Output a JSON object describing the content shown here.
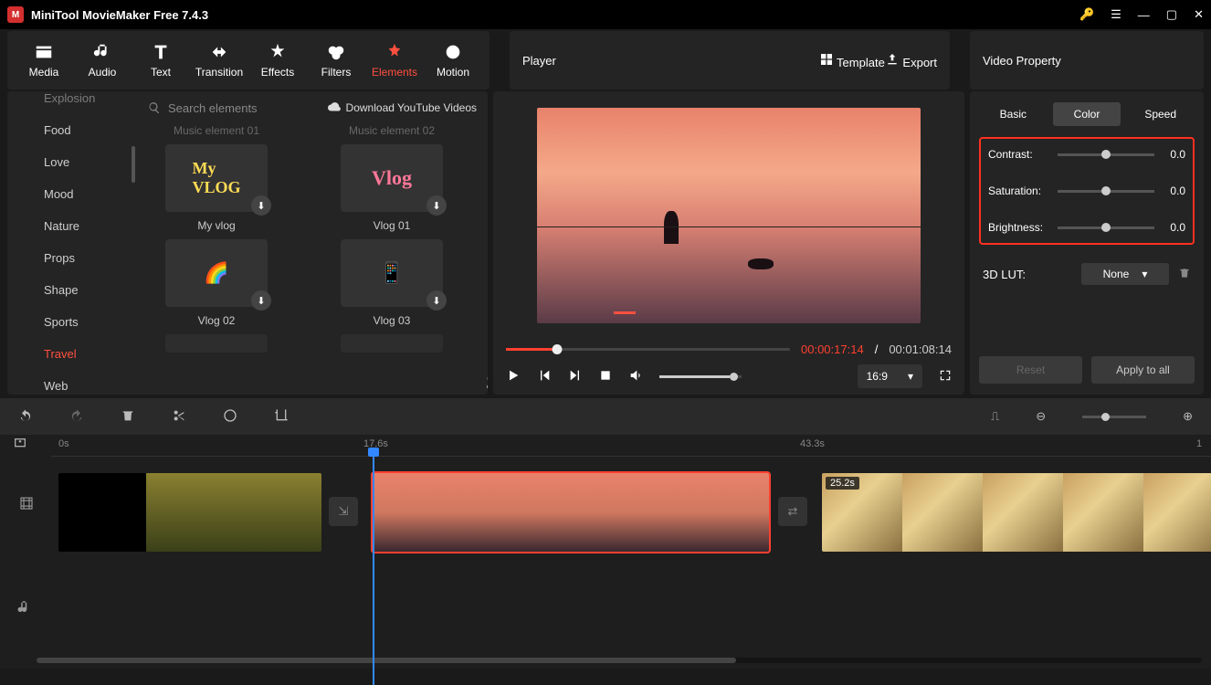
{
  "app": {
    "title": "MiniTool MovieMaker Free 7.4.3"
  },
  "toolbar": {
    "media": "Media",
    "audio": "Audio",
    "text": "Text",
    "transition": "Transition",
    "effects": "Effects",
    "filters": "Filters",
    "elements": "Elements",
    "motion": "Motion"
  },
  "categories": [
    "Explosion",
    "Food",
    "Love",
    "Mood",
    "Nature",
    "Props",
    "Shape",
    "Sports",
    "Travel",
    "Web"
  ],
  "active_category": "Travel",
  "search": {
    "placeholder": "Search elements"
  },
  "download_link": "Download YouTube Videos",
  "elements": {
    "row0": [
      "Music element 01",
      "Music element 02"
    ],
    "row1": [
      "My vlog",
      "Vlog 01"
    ],
    "row2": [
      "Vlog 02",
      "Vlog 03"
    ]
  },
  "player": {
    "title": "Player",
    "template": "Template",
    "export": "Export",
    "current": "00:00:17:14",
    "sep": " / ",
    "duration": "00:01:08:14",
    "aspect": "16:9"
  },
  "props": {
    "title": "Video Property",
    "tabs": {
      "basic": "Basic",
      "color": "Color",
      "speed": "Speed"
    },
    "contrast": {
      "label": "Contrast:",
      "value": "0.0"
    },
    "saturation": {
      "label": "Saturation:",
      "value": "0.0"
    },
    "brightness": {
      "label": "Brightness:",
      "value": "0.0"
    },
    "lut": {
      "label": "3D LUT:",
      "value": "None"
    },
    "reset": "Reset",
    "apply": "Apply to all"
  },
  "timeline": {
    "ticks": {
      "t0": "0s",
      "t1": "17.6s",
      "t2": "43.3s",
      "t3": "1"
    },
    "clip3_badge": "25.2s"
  }
}
